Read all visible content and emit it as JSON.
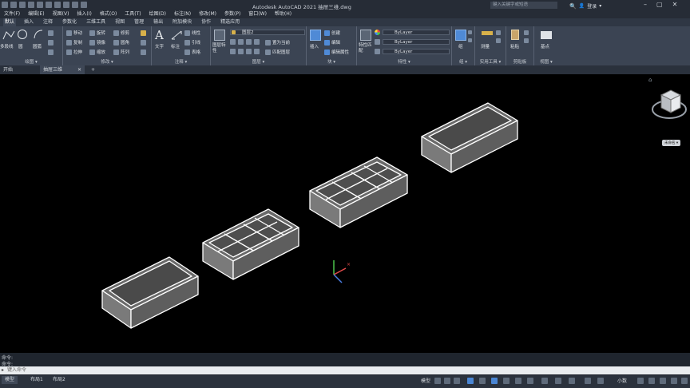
{
  "titlebar": {
    "title": "Autodesk AutoCAD 2021   抽屉三维.dwg",
    "search_placeholder": "键入关键字或短语",
    "login_label": "登录",
    "window_buttons": [
      "–",
      "▢",
      "✕"
    ]
  },
  "menu": [
    "文件(F)",
    "编辑(E)",
    "视图(V)",
    "插入(I)",
    "格式(O)",
    "工具(T)",
    "绘图(D)",
    "标注(N)",
    "修改(M)",
    "参数(P)",
    "窗口(W)",
    "帮助(H)"
  ],
  "ribbon_tabs": [
    "默认",
    "插入",
    "注释",
    "参数化",
    "三维工具",
    "视图",
    "管理",
    "输出",
    "附加模块",
    "协作",
    "精选应用"
  ],
  "ribbon": {
    "draw": {
      "title": "绘图 ▾",
      "polyline": "多段线",
      "circle": "圆",
      "arc": "圆弧"
    },
    "modify": {
      "title": "修改 ▾",
      "items": [
        "移动",
        "旋转",
        "修剪",
        "复制",
        "镜像",
        "圆角",
        "拉伸",
        "缩放",
        "阵列"
      ]
    },
    "annotation": {
      "title": "注释 ▾",
      "text": "文字",
      "dimension": "标注",
      "linear": "线性",
      "leader": "引线",
      "table": "表格"
    },
    "layers": {
      "title": "图层 ▾",
      "layer_props": "图层特性",
      "current_layer": "图层2",
      "set_current": "置为当前",
      "match_layer": "匹配图层"
    },
    "block": {
      "title": "块 ▾",
      "insert": "插入",
      "create": "创建",
      "edit": "编辑",
      "edit_attr": "编辑属性"
    },
    "properties": {
      "title": "特性 ▾",
      "match": "特性匹配",
      "bylayer": [
        "ByLayer",
        "ByLayer",
        "ByLayer"
      ]
    },
    "groups": {
      "title": "组 ▾",
      "group": "组"
    },
    "utilities": {
      "title": "实用工具 ▾",
      "measure": "测量"
    },
    "clipboard": {
      "title": "剪贴板",
      "paste": "粘贴"
    },
    "view": {
      "title": "视图 ▾",
      "base": "基点"
    }
  },
  "file_tabs": [
    "开始",
    "抽屉三维",
    "+"
  ],
  "viewcube": {
    "compass_label": "未命名 ▾"
  },
  "command": {
    "history": [
      "命令:",
      "命令:"
    ],
    "placeholder": "键入命令"
  },
  "status": {
    "layout_tabs": [
      "模型",
      "布局1",
      "布局2"
    ],
    "model_label": "模型",
    "units_label": "小数"
  }
}
